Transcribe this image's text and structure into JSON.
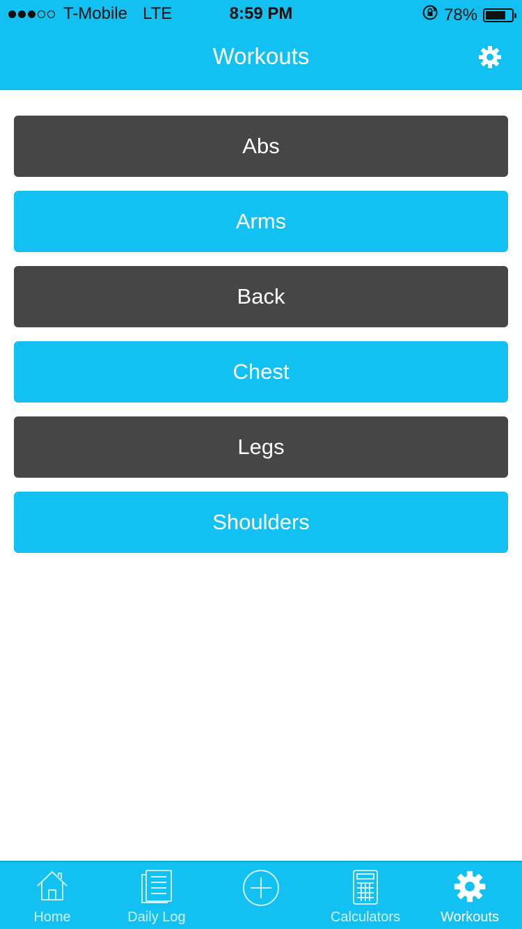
{
  "status_bar": {
    "carrier": "T-Mobile",
    "network": "LTE",
    "time": "8:59 PM",
    "battery_percent": "78%",
    "battery_level": 0.78,
    "signal_bars_filled": 3,
    "signal_bars_total": 5
  },
  "nav": {
    "title": "Workouts",
    "settings_icon": "gear-icon"
  },
  "categories": [
    {
      "label": "Abs",
      "style": "dark"
    },
    {
      "label": "Arms",
      "style": "blue"
    },
    {
      "label": "Back",
      "style": "dark"
    },
    {
      "label": "Chest",
      "style": "blue"
    },
    {
      "label": "Legs",
      "style": "dark"
    },
    {
      "label": "Shoulders",
      "style": "blue"
    }
  ],
  "tabs": [
    {
      "label": "Home",
      "icon": "home-icon"
    },
    {
      "label": "Daily Log",
      "icon": "daily-log-icon"
    },
    {
      "label": "",
      "icon": "add-circle-icon"
    },
    {
      "label": "Calculators",
      "icon": "calculator-icon"
    },
    {
      "label": "Workouts",
      "icon": "gear-icon",
      "active": true
    }
  ],
  "colors": {
    "accent": "#12c1f2",
    "dark_button": "#464646",
    "white": "#ffffff"
  }
}
